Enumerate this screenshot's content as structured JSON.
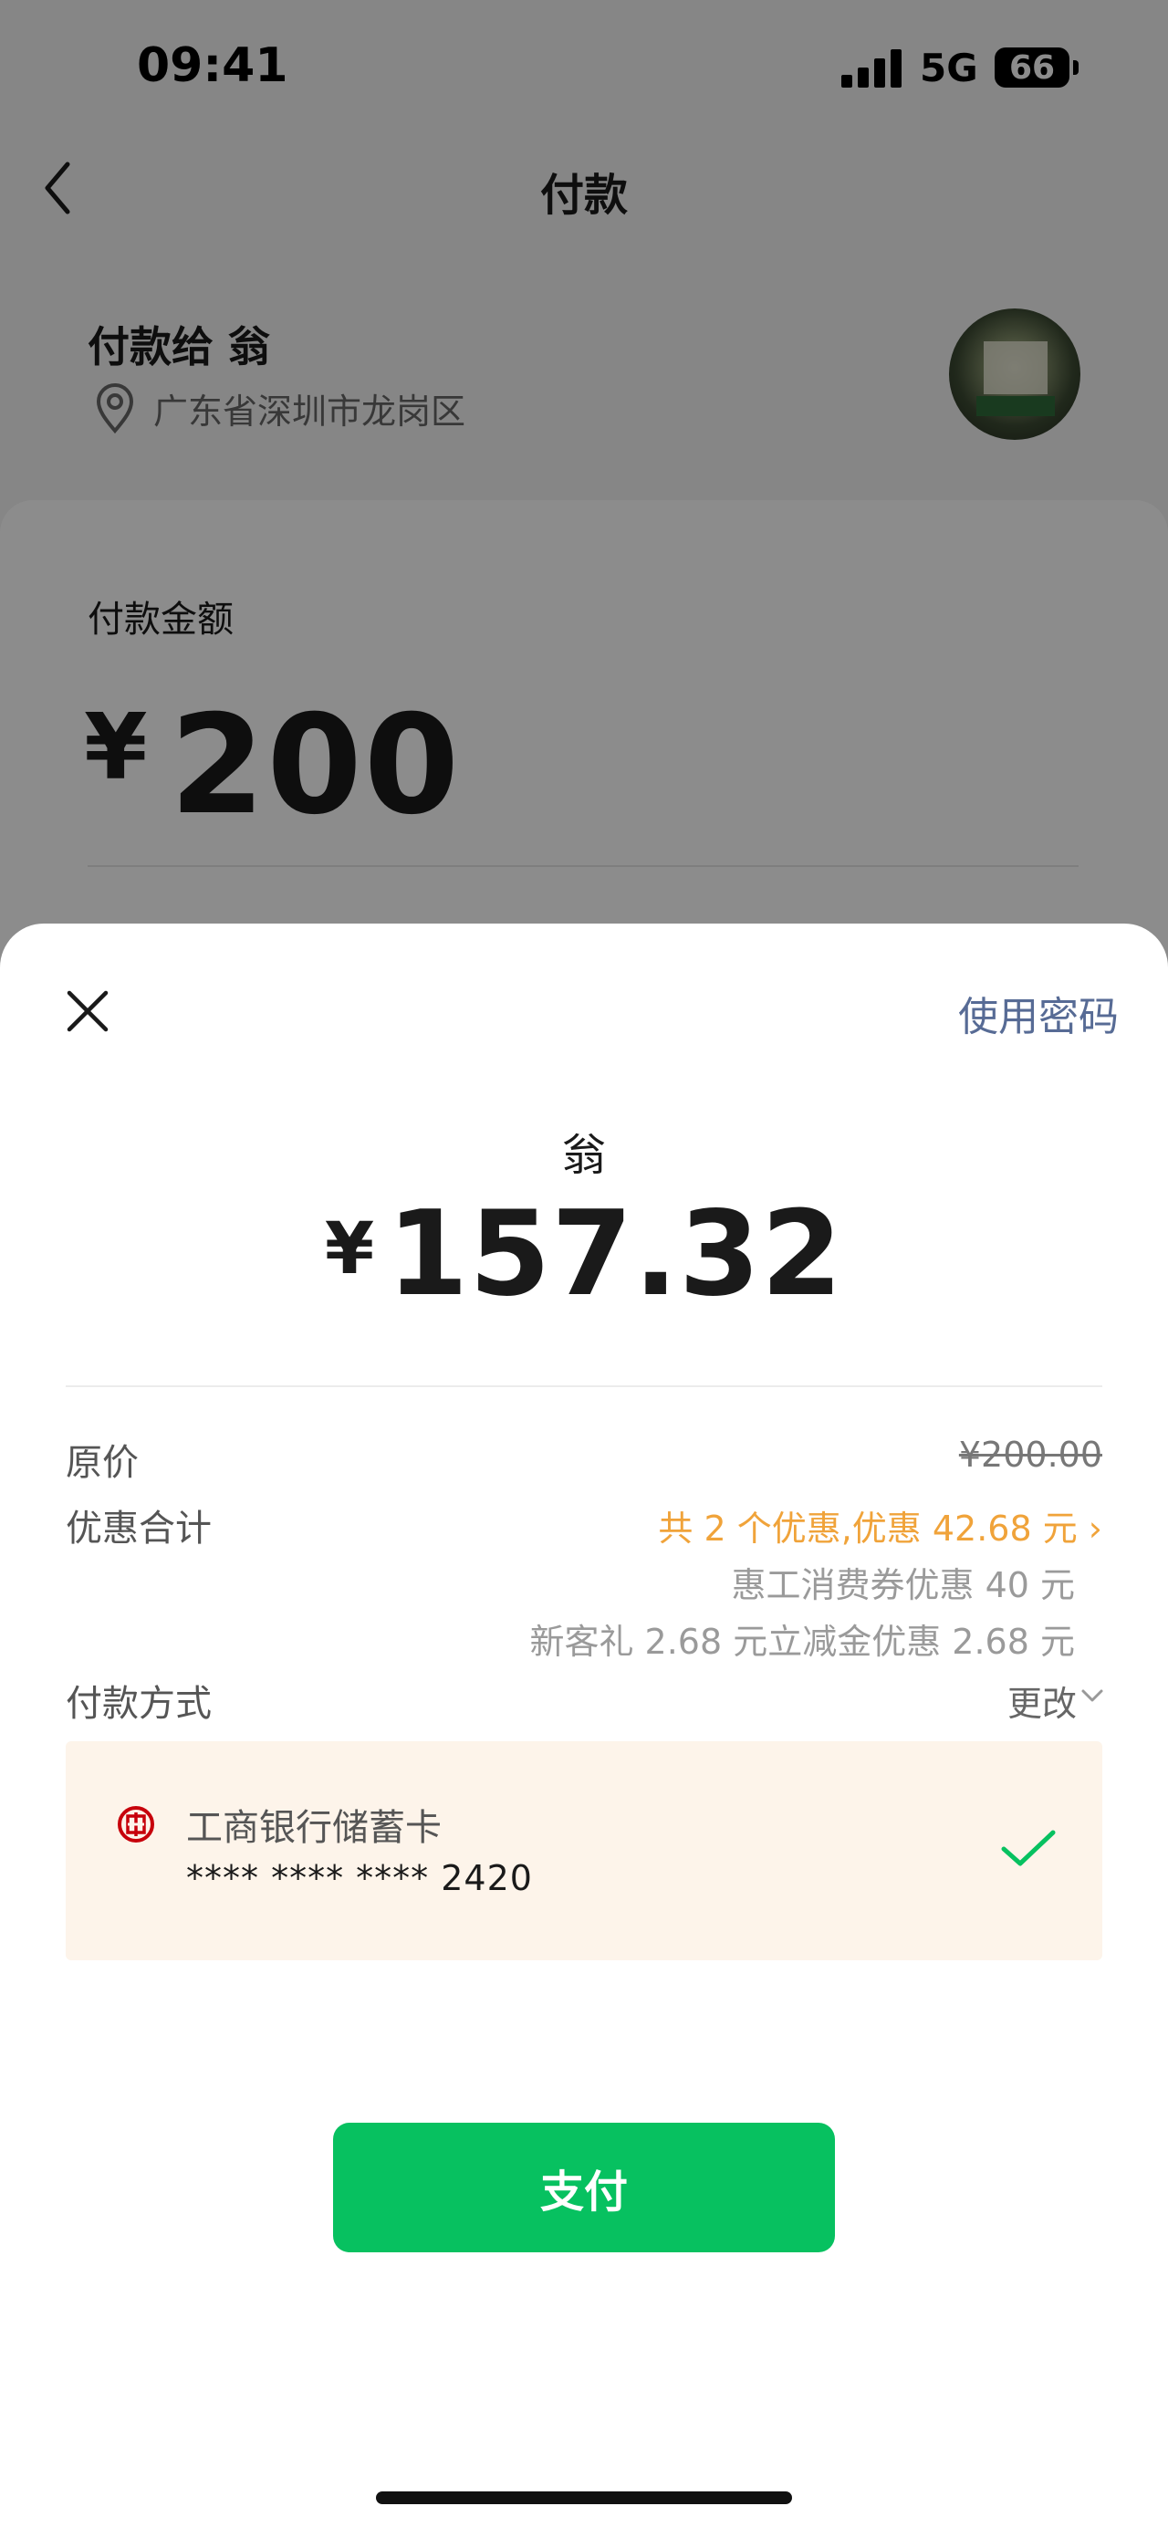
{
  "status_bar": {
    "time": "09:41",
    "network": "5G",
    "battery": "66"
  },
  "header": {
    "title": "付款"
  },
  "payee": {
    "label": "付款给 翁",
    "location": "广东省深圳市龙岗区"
  },
  "amount_section": {
    "label": "付款金额",
    "currency": "¥",
    "amount": "200"
  },
  "sheet": {
    "use_password": "使用密码",
    "payee_name": "翁",
    "currency": "¥",
    "final_amount": "157.32",
    "original_price_label": "原价",
    "original_price": "¥200.00",
    "discount_label": "优惠合计",
    "discount_summary": "共 2 个优惠,优惠 42.68 元 ›",
    "discount_details": [
      "惠工消费券优惠 40 元",
      "新客礼 2.68 元立减金优惠 2.68 元"
    ],
    "payment_method_label": "付款方式",
    "change_label": "更改",
    "card": {
      "bank": "工商银行储蓄卡",
      "number": "**** **** **** 2420"
    },
    "pay_button": "支付"
  },
  "colors": {
    "accent_green": "#07c160",
    "discount_orange": "#f0a33a",
    "link_blue": "#576b95",
    "card_bg": "#fdf4ea",
    "bank_red": "#c7000b"
  }
}
